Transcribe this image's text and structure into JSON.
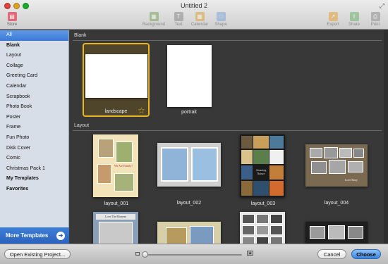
{
  "window": {
    "title": "Untitled 2"
  },
  "toolbar": {
    "store_label": "Store",
    "background_label": "Background",
    "text_label": "Text",
    "calendar_label": "Calendar",
    "shape_label": "Shape",
    "export_label": "Export",
    "share_label": "Share",
    "print_label": "Print"
  },
  "sidebar": {
    "items": [
      {
        "label": "All"
      },
      {
        "label": "Blank"
      },
      {
        "label": "Layout"
      },
      {
        "label": "Collage"
      },
      {
        "label": "Greeting Card"
      },
      {
        "label": "Calendar"
      },
      {
        "label": "Scrapbook"
      },
      {
        "label": "Photo Book"
      },
      {
        "label": "Poster"
      },
      {
        "label": "Frame"
      },
      {
        "label": "Fun Photo"
      },
      {
        "label": "Disk Cover"
      },
      {
        "label": "Comic"
      },
      {
        "label": "Christmas Pack 1"
      },
      {
        "label": "My Templates"
      },
      {
        "label": "Favorites"
      }
    ],
    "more_templates": "More Templates"
  },
  "main": {
    "blank_section": "Blank",
    "layout_section": "Layout",
    "blank_items": [
      {
        "label": "landscape"
      },
      {
        "label": "portrait"
      }
    ],
    "layout_items": [
      {
        "label": "layout_001"
      },
      {
        "label": "layout_002"
      },
      {
        "label": "layout_003"
      },
      {
        "label": "layout_004"
      }
    ],
    "thumb_texts": {
      "we_are_family": "We Are Family!",
      "amazing_nature": "Amazing Nature",
      "love_story": "Love Story",
      "love_the_moment": "Love The Moment"
    }
  },
  "footer": {
    "open_existing": "Open Existing Project...",
    "cancel": "Cancel",
    "choose": "Choose"
  },
  "colors": {
    "accent_blue": "#3b79d6",
    "selection_gold": "#e8b81d",
    "content_bg": "#383838"
  }
}
